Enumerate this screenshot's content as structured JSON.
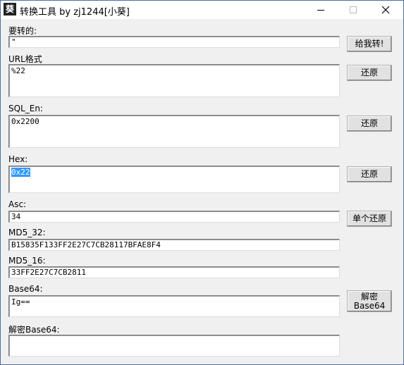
{
  "window": {
    "title": "转换工具 by zj1244[小葵]",
    "app_icon_glyph": "葵",
    "controls": {
      "minimize": "minimize-icon",
      "maximize": "maximize-icon",
      "close": "close-icon"
    }
  },
  "fields": {
    "input": {
      "label": "要转的:",
      "value": "\""
    },
    "url": {
      "label": "URL格式",
      "value": "%22"
    },
    "sql": {
      "label": "SQL_En:",
      "value": "0x2200"
    },
    "hex": {
      "label": "Hex:",
      "value": "0x22"
    },
    "asc": {
      "label": "Asc:",
      "value": "34"
    },
    "md5_32": {
      "label": "MD5_32:",
      "value": "B15835F133FF2E27C7CB28117BFAE8F4"
    },
    "md5_16": {
      "label": "MD5_16:",
      "value": "33FF2E27C7CB2811"
    },
    "base64": {
      "label": "Base64:",
      "value": "Ig=="
    },
    "base64_decode": {
      "label": "解密Base64:",
      "value": ""
    }
  },
  "buttons": {
    "convert": "给我转!",
    "restore_url": "还原",
    "restore_sql": "还原",
    "restore_hex": "还原",
    "restore_asc": "单个还原",
    "decode_base64_line1": "解密",
    "decode_base64_line2": "Base64"
  }
}
